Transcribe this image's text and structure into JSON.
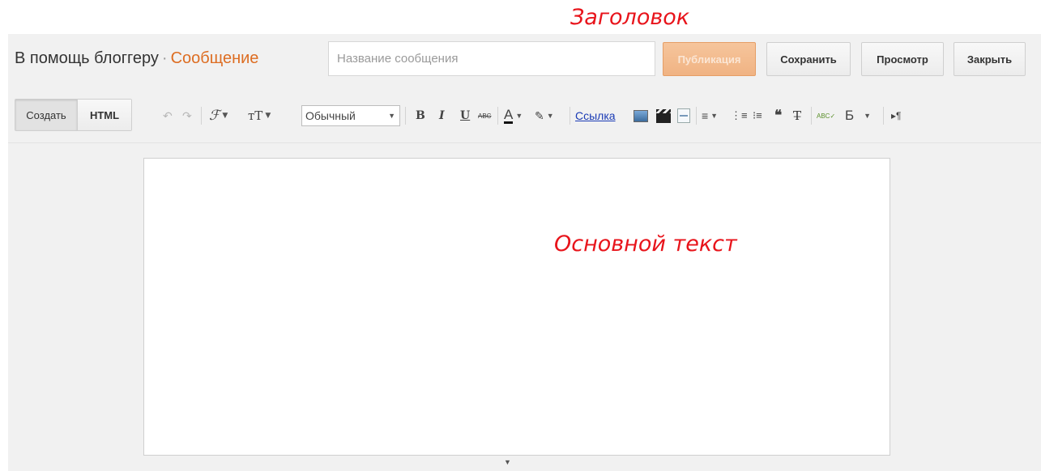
{
  "annotations": {
    "title_hint": "Заголовок",
    "body_hint": "Основной текст"
  },
  "header": {
    "blog_name": "В помощь блоггеру",
    "separator": "·",
    "section": "Сообщение",
    "post_title_placeholder": "Название сообщения",
    "post_title_value": "",
    "buttons": {
      "publish": "Публикация",
      "save": "Сохранить",
      "preview": "Просмотр",
      "close": "Закрыть"
    }
  },
  "toolbar": {
    "modes": [
      "Создать",
      "HTML"
    ],
    "active_mode": "Создать",
    "font_size_value": "Обычный",
    "link_label": "Ссылка",
    "icons": {
      "undo": "↶",
      "redo": "↷",
      "font": "ℱ",
      "text_size": "тT",
      "bold": "B",
      "italic": "I",
      "underline": "U",
      "strikethrough": "ABC",
      "text_color": "A",
      "highlight": "✎",
      "align": "≡",
      "numbered_list": "⋮≡",
      "bulleted_list": "⁝≡",
      "quote": "❝",
      "remove_format": "T̶",
      "spellcheck": "ABC✓",
      "transliterate": "Б",
      "ltr": "▸¶"
    }
  },
  "colors": {
    "accent_orange": "#dd6d22",
    "annotation_red": "#e8141b",
    "link_blue": "#1a3bb5"
  }
}
